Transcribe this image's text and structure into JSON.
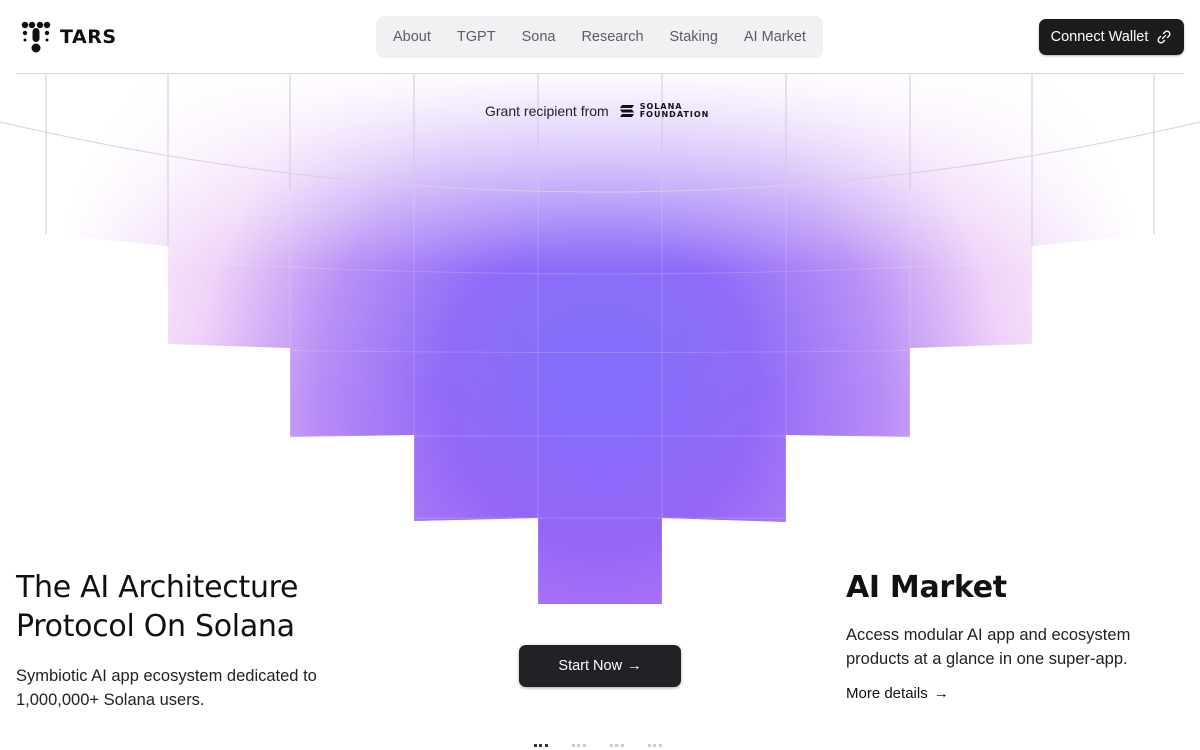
{
  "brand": {
    "name": "TARS"
  },
  "nav": {
    "items": [
      {
        "label": "About"
      },
      {
        "label": "TGPT"
      },
      {
        "label": "Sona"
      },
      {
        "label": "Research"
      },
      {
        "label": "Staking"
      },
      {
        "label": "AI Market"
      }
    ]
  },
  "header": {
    "connect_label": "Connect Wallet"
  },
  "grant": {
    "text": "Grant recipient from",
    "logo_line1": "SOLANA",
    "logo_line2": "FOUNDATION"
  },
  "hero": {
    "title_line1": "The AI Architecture",
    "title_line2": "Protocol On Solana",
    "sub_line1": "Symbiotic AI app ecosystem dedicated to",
    "sub_line2": "1,000,000+ Solana users.",
    "cta": "Start Now",
    "cta_arrow": "→"
  },
  "market": {
    "title": "AI Market",
    "sub_line1": "Access modular AI app and ecosystem",
    "sub_line2": "products at a glance in one super-app.",
    "link": "More details",
    "link_arrow": "→"
  },
  "carousel": {
    "active_index": 0,
    "count": 4
  },
  "colors": {
    "accent_purple": "#8b5cf6",
    "accent_violet": "#a855f7",
    "button_dark": "#1c1c1f",
    "nav_bg": "#f1f1f3"
  }
}
